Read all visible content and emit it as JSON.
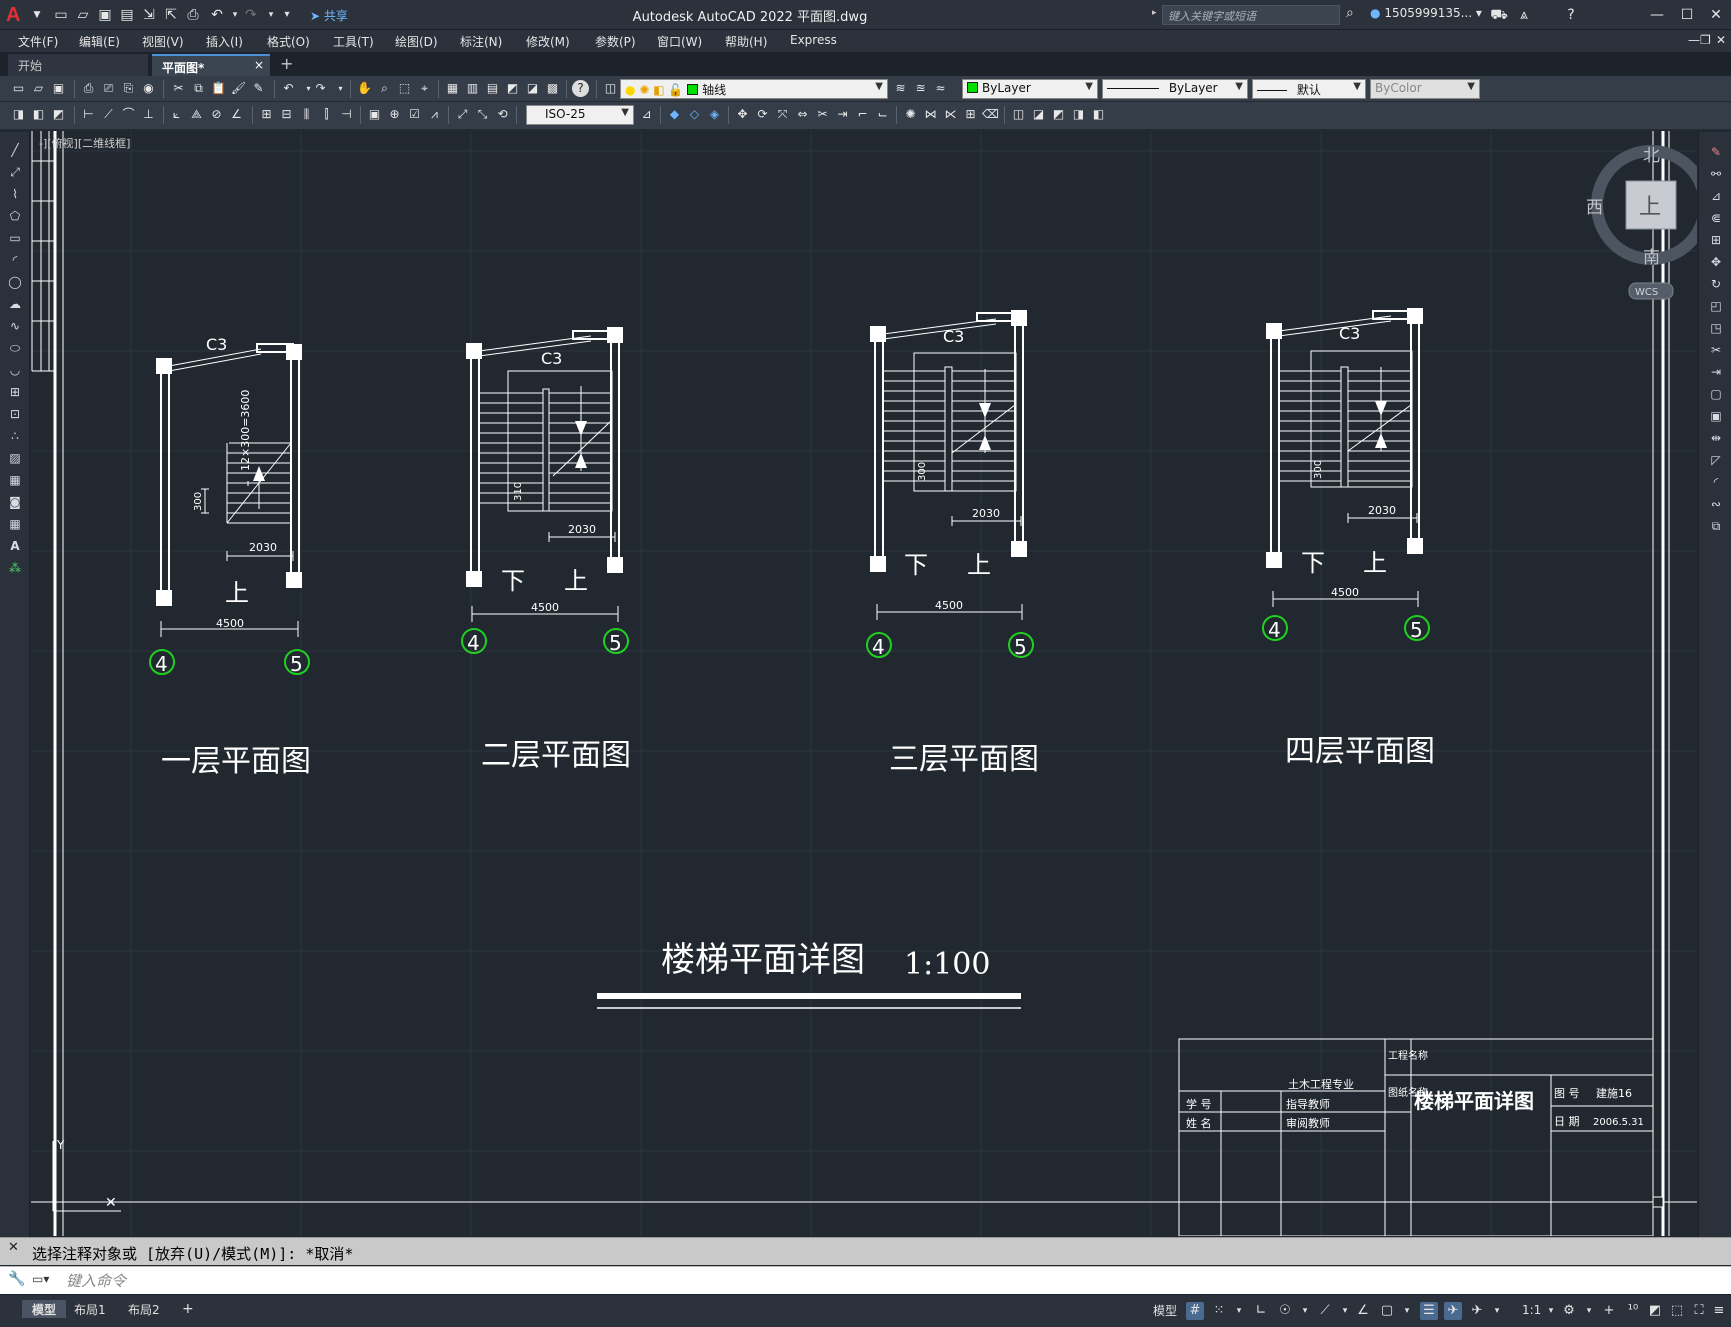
{
  "app": {
    "logo_letter": "A",
    "window_title": "Autodesk AutoCAD 2022    平面图.dwg",
    "share_label": "共享",
    "search_placeholder": "键入关键字或短语",
    "user_name": "1505999135...",
    "window_controls": [
      "minimize-icon",
      "maximize-icon",
      "close-icon"
    ]
  },
  "menu": [
    "文件(F)",
    "编辑(E)",
    "视图(V)",
    "插入(I)",
    "格式(O)",
    "工具(T)",
    "绘图(D)",
    "标注(N)",
    "修改(M)",
    "参数(P)",
    "窗口(W)",
    "帮助(H)",
    "Express"
  ],
  "tabs": {
    "start": "开始",
    "active": "平面图*",
    "close": "×",
    "add": "+"
  },
  "toolbar": {
    "layer_value": "轴线",
    "color_value": "ByLayer",
    "linetype_value": "ByLayer",
    "lineweight_value": "默认",
    "plotstyle_value": "ByColor",
    "dimstyle_value": "ISO-25",
    "layer_color": "#00e000"
  },
  "viewport": {
    "label": "-][俯视][二维线框]"
  },
  "viewcube": {
    "north": "北",
    "south": "南",
    "east": "东",
    "west": "西",
    "top": "上",
    "wcs": "WCS"
  },
  "drawing": {
    "floors": [
      {
        "title": "一层平面图",
        "window": "C3",
        "width_dim": "4500",
        "run_dim": "2030",
        "tread_dim": "12×300=3600",
        "small_dim": "300",
        "up": "上",
        "down": "",
        "axis_left": "4",
        "axis_right": "5"
      },
      {
        "title": "二层平面图",
        "window": "C3",
        "width_dim": "4500",
        "run_dim": "2030",
        "small_dim": "310",
        "up": "上",
        "down": "下",
        "axis_left": "4",
        "axis_right": "5"
      },
      {
        "title": "三层平面图",
        "window": "C3",
        "width_dim": "4500",
        "run_dim": "2030",
        "small_dim": "300",
        "up": "上",
        "down": "下",
        "axis_left": "4",
        "axis_right": "5"
      },
      {
        "title": "四层平面图",
        "window": "C3",
        "width_dim": "4500",
        "run_dim": "2030",
        "small_dim": "300",
        "up": "上",
        "down": "下",
        "axis_left": "4",
        "axis_right": "5"
      }
    ],
    "main_title": "楼梯平面详图",
    "scale": "1:100",
    "title_block": {
      "project_label": "工程名称",
      "drawing_label": "图纸名称",
      "drawing_name": "楼梯平面详图",
      "major": "土木工程专业",
      "student_id_label": "学  号",
      "advisor_label": "指导教师",
      "name_label": "姓  名",
      "reviewer_label": "审阅教师",
      "sheet_no_label": "图  号",
      "sheet_no": "建施16",
      "date_label": "日  期",
      "date": "2006.5.31"
    }
  },
  "command": {
    "history": "选择注释对象或 [放弃(U)/模式(M)]: *取消*",
    "placeholder": "键入命令"
  },
  "status": {
    "layouts": [
      "模型",
      "布局1",
      "布局2"
    ],
    "add_layout": "+",
    "model_label": "模型",
    "scale": "1:1"
  }
}
